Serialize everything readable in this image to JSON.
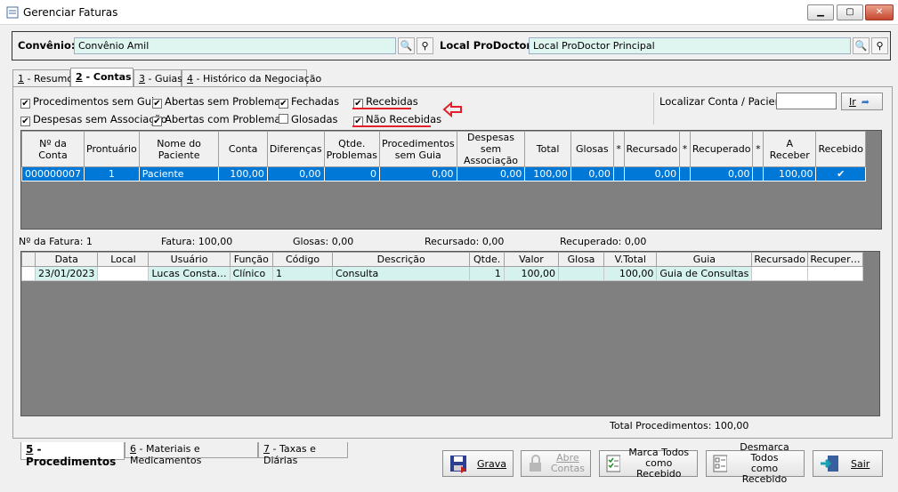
{
  "window": {
    "title": "Gerenciar Faturas"
  },
  "top": {
    "convenio_label": "Convênio:",
    "convenio_value": "Convênio Amil",
    "local_label": "Local ProDoctor:",
    "local_value": "Local ProDoctor Principal"
  },
  "tabs": [
    {
      "key": "1",
      "label": " - Resumo"
    },
    {
      "key": "2",
      "label": " - Contas"
    },
    {
      "key": "3",
      "label": " - Guias"
    },
    {
      "key": "4",
      "label": " - Histórico da Negociação"
    }
  ],
  "filters": {
    "procedimentos_sem_guia": "Procedimentos sem Guia",
    "despesas_sem_associacao": "Despesas sem Associação",
    "abertas_sem_problemas": "Abertas sem Problemas",
    "abertas_com_problemas": "Abertas com Problemas",
    "fechadas": "Fechadas",
    "glosadas": "Glosadas",
    "recebidas": "Recebidas",
    "nao_recebidas": "Não Recebidas"
  },
  "search": {
    "label": "Localizar Conta / Paciente:",
    "value": "",
    "go_label": "Ir"
  },
  "accounts_table": {
    "headers": [
      "Nº da Conta",
      "Prontuário",
      "Nome do Paciente",
      "Conta",
      "Diferenças",
      "Qtde. Problemas",
      "Procedimentos sem Guia",
      "Despesas sem Associação",
      "Total",
      "Glosas",
      "*",
      "Recursado",
      "*",
      "Recuperado",
      "*",
      "A Receber",
      "Recebido"
    ],
    "rows": [
      [
        "000000007",
        "1",
        "Paciente",
        "100,00",
        "0,00",
        "0",
        "0,00",
        "0,00",
        "100,00",
        "0,00",
        "",
        "0,00",
        "",
        "0,00",
        "",
        "100,00",
        "✔"
      ]
    ]
  },
  "summary": {
    "fatura_no": "Nº da Fatura: 1",
    "fatura": "Fatura: 100,00",
    "glosas": "Glosas: 0,00",
    "recursado": "Recursado: 0,00",
    "recuperado": "Recuperado: 0,00"
  },
  "procedures_table": {
    "headers": [
      "",
      "Data",
      "Local",
      "Usuário",
      "Função",
      "Código",
      "Descrição",
      "Qtde.",
      "Valor",
      "Glosa",
      "V.Total",
      "Guia",
      "Recursado",
      "Recuper…"
    ],
    "rows": [
      [
        "",
        "23/01/2023",
        "",
        "Lucas Consta…",
        "Clínico",
        "1",
        "Consulta",
        "1",
        "100,00",
        "",
        "100,00",
        "Guia de Consultas",
        "",
        ""
      ]
    ]
  },
  "total_procedimentos": "Total Procedimentos: 100,00",
  "bottom_tabs": [
    {
      "key": "5",
      "label": " - Procedimentos"
    },
    {
      "key": "6",
      "label": " - Materiais e Medicamentos"
    },
    {
      "key": "7",
      "label": " - Taxas e Diárias"
    }
  ],
  "buttons": {
    "grava": "Grava",
    "abre_contas_1": "Abre",
    "abre_contas_2": "Contas",
    "marca_todos_1": "Marca Todos",
    "marca_todos_2": "como Recebido",
    "desmarca_todos_1": "Desmarca Todos",
    "desmarca_todos_2": "como Recebido",
    "sair": "Sair"
  },
  "colors": {
    "accent": "#0078d7",
    "field_bg": "#dff5f0",
    "annotation": "#e0202a"
  }
}
